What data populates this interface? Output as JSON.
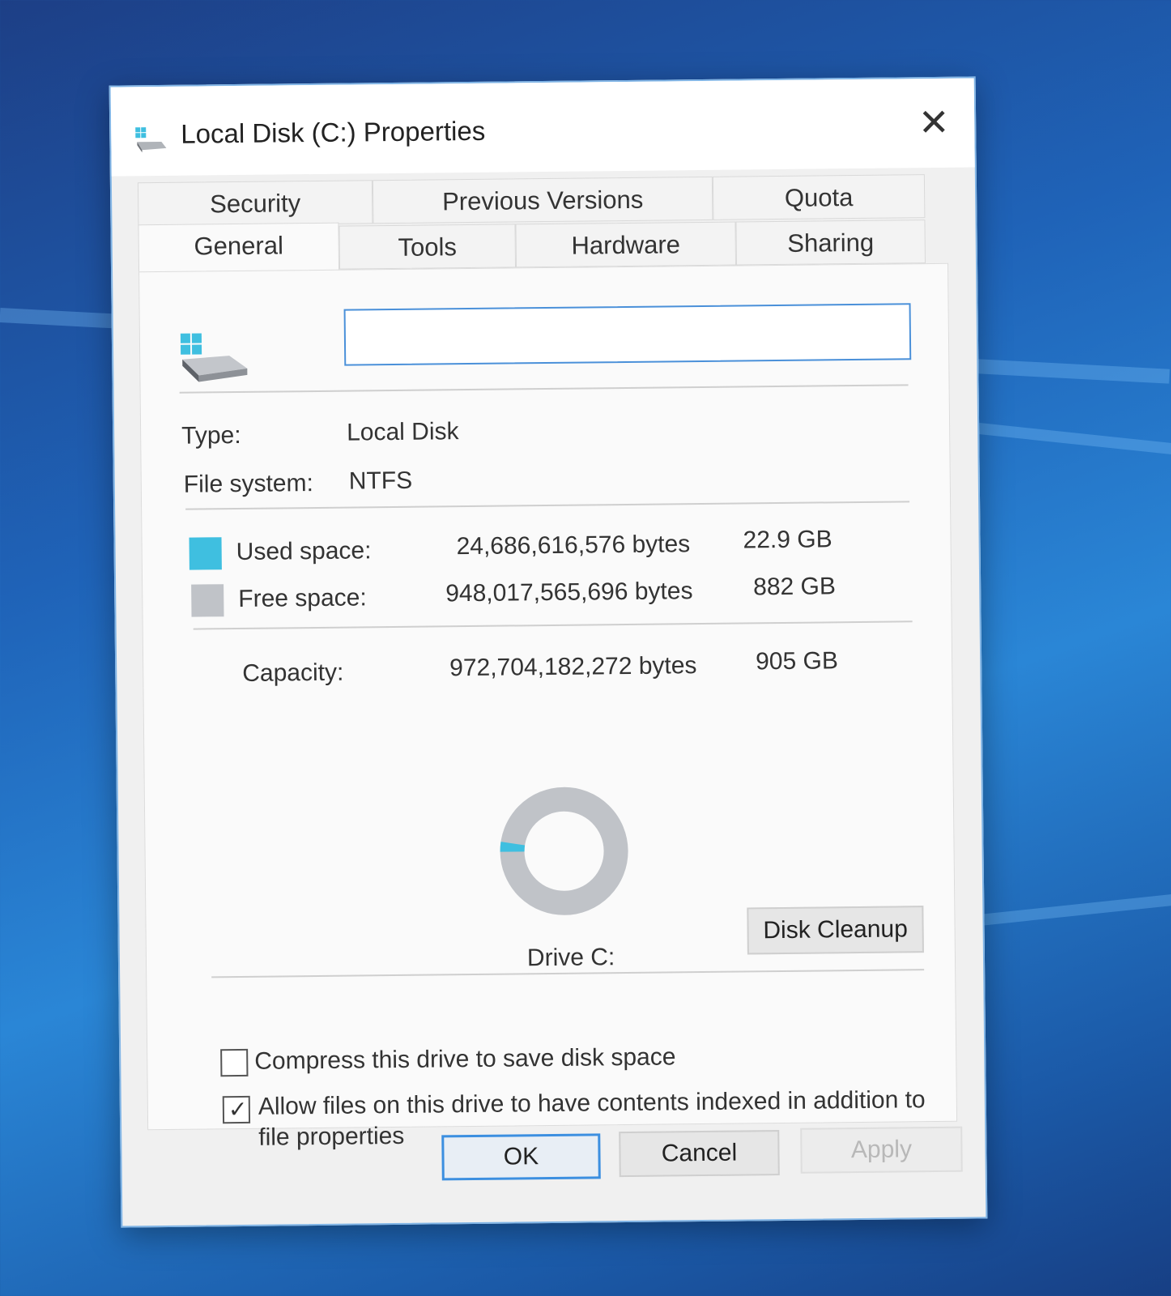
{
  "window": {
    "title": "Local Disk (C:) Properties",
    "close_glyph": "✕"
  },
  "tabs": {
    "row_back": [
      {
        "label": "Security"
      },
      {
        "label": "Previous Versions"
      },
      {
        "label": "Quota"
      }
    ],
    "row_front": [
      {
        "label": "General",
        "active": true
      },
      {
        "label": "Tools"
      },
      {
        "label": "Hardware"
      },
      {
        "label": "Sharing"
      }
    ]
  },
  "general": {
    "name_value": "",
    "type_label": "Type:",
    "type_value": "Local Disk",
    "fs_label": "File system:",
    "fs_value": "NTFS",
    "used_label": "Used space:",
    "used_bytes": "24,686,616,576 bytes",
    "used_size": "22.9 GB",
    "used_color": "#3fbfe0",
    "free_label": "Free space:",
    "free_bytes": "948,017,565,696 bytes",
    "free_size": "882 GB",
    "free_color": "#c0c3c8",
    "capacity_label": "Capacity:",
    "capacity_bytes": "972,704,182,272 bytes",
    "capacity_size": "905 GB",
    "used_fraction": 0.0254,
    "drive_label": "Drive C:",
    "cleanup_label": "Disk Cleanup",
    "compress_label": "Compress this drive to save disk space",
    "compress_checked": false,
    "index_label_line1": "Allow files on this drive to have contents indexed in addition to",
    "index_label_line2": "file properties",
    "index_checked": true,
    "check_glyph": "✓"
  },
  "buttons": {
    "ok": "OK",
    "cancel": "Cancel",
    "apply": "Apply"
  }
}
